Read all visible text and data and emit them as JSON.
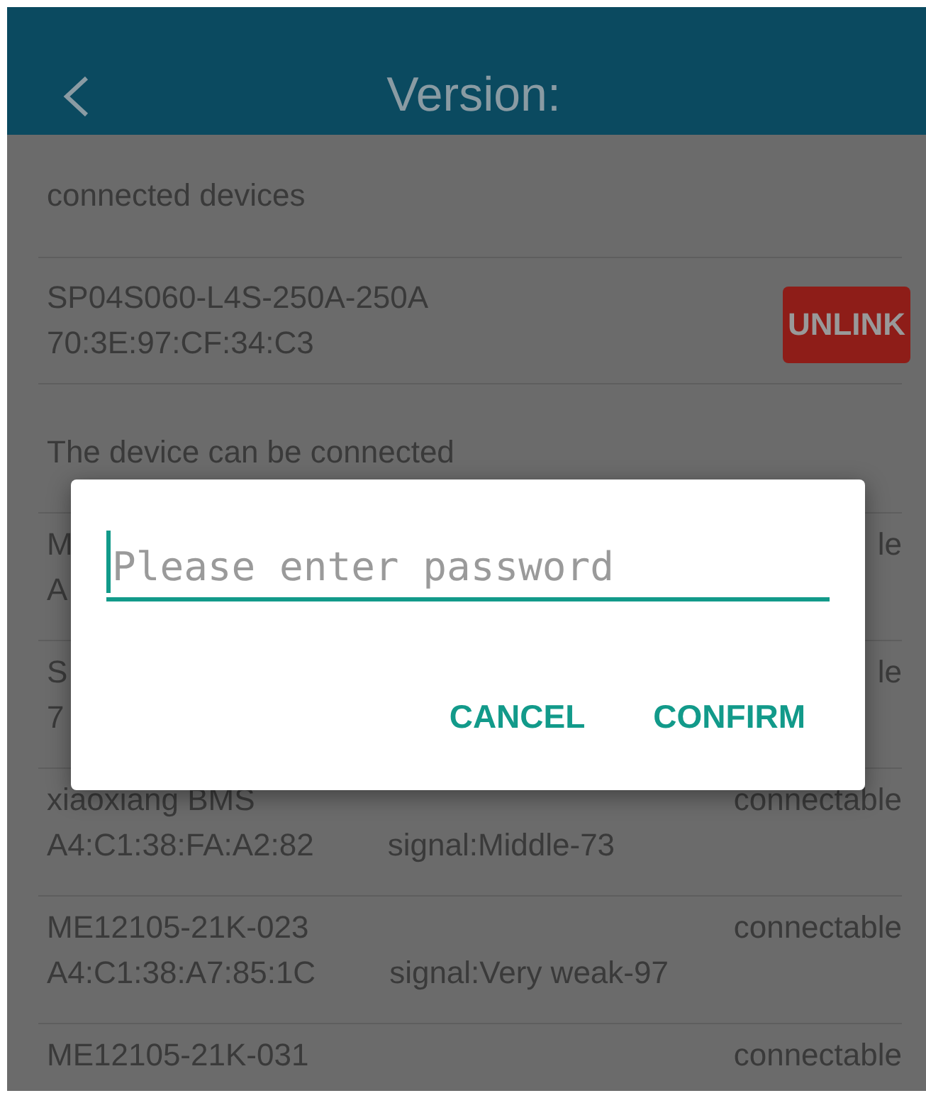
{
  "header": {
    "title": "Version:"
  },
  "connected_section": {
    "label": "connected devices"
  },
  "connected_devices": [
    {
      "name": "SP04S060-L4S-250A-250A",
      "mac": "70:3E:97:CF:34:C3",
      "action": "UNLINK"
    }
  ],
  "available_section": {
    "label": "The device can be connected"
  },
  "available_devices": [
    {
      "name": "M",
      "mac": "A",
      "status": "le"
    },
    {
      "name": "S",
      "mac": "7",
      "status": "le"
    },
    {
      "name": "xiaoxiang BMS",
      "mac": "A4:C1:38:FA:A2:82",
      "signal": "signal:Middle-73",
      "status": "connectable"
    },
    {
      "name": "ME12105-21K-023",
      "mac": "A4:C1:38:A7:85:1C",
      "signal": "signal:Very weak-97",
      "status": "connectable"
    },
    {
      "name": "ME12105-21K-031",
      "status": "connectable"
    }
  ],
  "dialog": {
    "placeholder": "Please enter password",
    "buttons": [
      "CANCEL",
      "CONFIRM"
    ]
  }
}
